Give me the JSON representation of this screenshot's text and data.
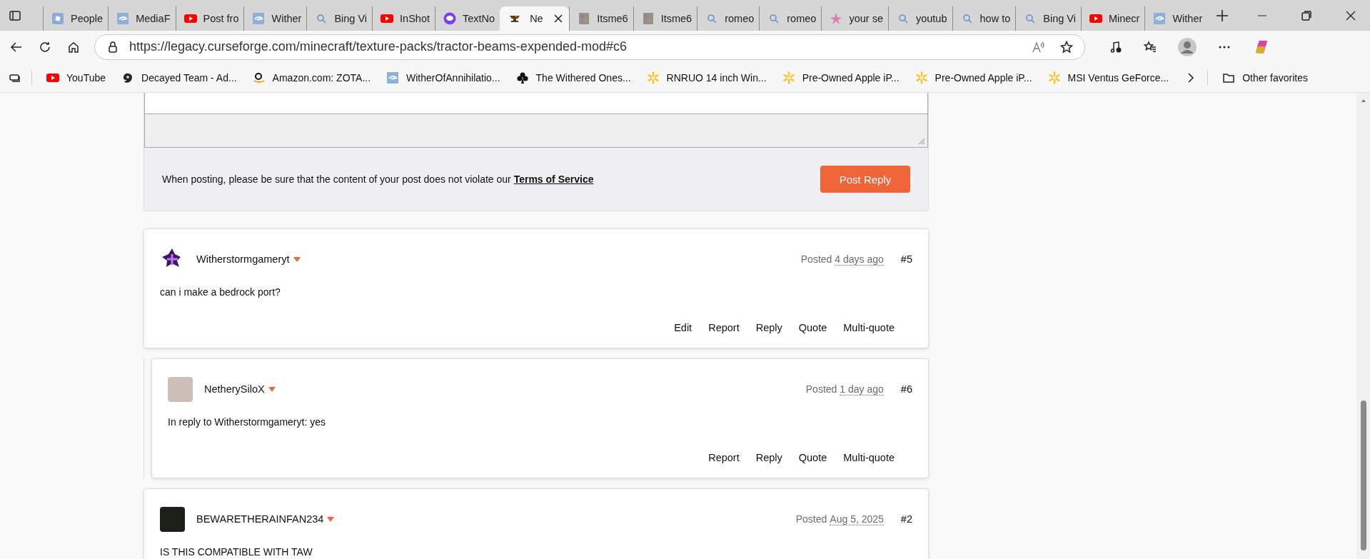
{
  "tabs": [
    {
      "label": "People",
      "kind": "square",
      "selected": false
    },
    {
      "label": "MediaF",
      "kind": "swirl",
      "selected": false
    },
    {
      "label": "Post fro",
      "kind": "youtube",
      "selected": false
    },
    {
      "label": "Wither",
      "kind": "swirl",
      "selected": false
    },
    {
      "label": "Bing Vi",
      "kind": "search",
      "selected": false
    },
    {
      "label": "InShot",
      "kind": "youtube",
      "selected": false
    },
    {
      "label": "TextNo",
      "kind": "chat",
      "selected": false
    },
    {
      "label": "Ne",
      "kind": "anvil",
      "selected": true
    },
    {
      "label": "Itsme6",
      "kind": "pixel",
      "selected": false
    },
    {
      "label": "Itsme6",
      "kind": "pixel",
      "selected": false
    },
    {
      "label": "romeo",
      "kind": "search",
      "selected": false
    },
    {
      "label": "romeo",
      "kind": "search",
      "selected": false
    },
    {
      "label": "your se",
      "kind": "star",
      "selected": false
    },
    {
      "label": "youtub",
      "kind": "search",
      "selected": false
    },
    {
      "label": "how to",
      "kind": "search",
      "selected": false
    },
    {
      "label": "Bing Vi",
      "kind": "search",
      "selected": false
    },
    {
      "label": "Minecr",
      "kind": "youtube",
      "selected": false
    },
    {
      "label": "Wither",
      "kind": "swirl",
      "selected": false
    }
  ],
  "address_bar": {
    "url": "https://legacy.curseforge.com/minecraft/texture-packs/tractor-beams-expended-mod#c6"
  },
  "bookmarks": [
    {
      "label": "YouTube",
      "kind": "youtube"
    },
    {
      "label": "Decayed Team - Ad...",
      "kind": "blob"
    },
    {
      "label": "Amazon.com: ZOTA...",
      "kind": "smile"
    },
    {
      "label": "WitherOfAnnihilatio...",
      "kind": "swirl"
    },
    {
      "label": "The Withered Ones...",
      "kind": "club"
    },
    {
      "label": "RNRUO 14 inch Win...",
      "kind": "spark"
    },
    {
      "label": "Pre-Owned Apple iP...",
      "kind": "spark"
    },
    {
      "label": "Pre-Owned Apple iP...",
      "kind": "spark"
    },
    {
      "label": "MSI Ventus GeForce...",
      "kind": "spark"
    }
  ],
  "other_favorites": "Other favorites",
  "reply_form": {
    "notice": "When posting, please be sure that the content of your post does not violate our **Terms of Service**",
    "button": "Post Reply"
  },
  "posts": [
    {
      "author": "Witherstormgameryt",
      "kind": "pixel",
      "nested": false,
      "posted": "Posted",
      "time": "4 days ago",
      "number": "#5",
      "body": "can i make a bedrock port?",
      "actions": [
        "Edit",
        "Report",
        "Reply",
        "Quote",
        "Multi-quote"
      ]
    },
    {
      "author": "NetherySiloX",
      "kind": "photo",
      "nested": true,
      "posted": "Posted",
      "time": "1 day ago",
      "number": "#6",
      "body": "In reply to Witherstormgameryt: yes",
      "actions": [
        "Report",
        "Reply",
        "Quote",
        "Multi-quote"
      ]
    },
    {
      "author": "BEWARETHERAINFAN234",
      "kind": "dark",
      "nested": false,
      "posted": "Posted",
      "time": "Aug 5, 2025",
      "number": "#2",
      "body": "IS THIS COMPATIBLE WITH TAW"
    }
  ]
}
